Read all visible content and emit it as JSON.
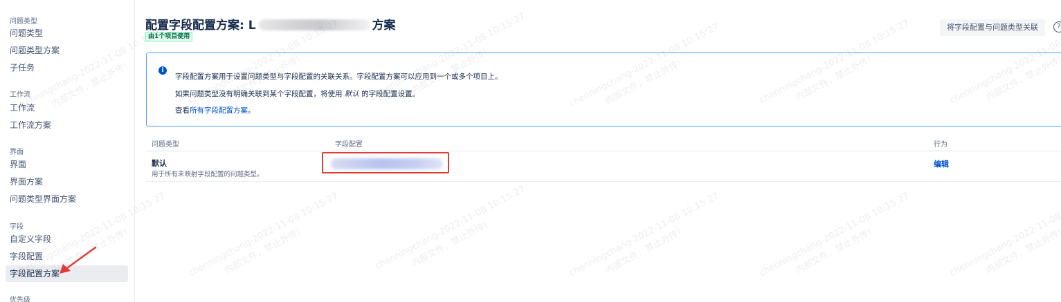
{
  "sidebar": {
    "groups": [
      {
        "title": "问题类型",
        "items": [
          "问题类型",
          "问题类型方案",
          "子任务"
        ]
      },
      {
        "title": "工作流",
        "items": [
          "工作流",
          "工作流方案"
        ]
      },
      {
        "title": "界面",
        "items": [
          "界面",
          "界面方案",
          "问题类型界面方案"
        ]
      },
      {
        "title": "字段",
        "items": [
          "自定义字段",
          "字段配置",
          "字段配置方案"
        ]
      },
      {
        "title": "优先级"
      }
    ],
    "active_item": "字段配置方案"
  },
  "header": {
    "title_prefix": "配置字段配置方案: L",
    "title_suffix": "方案",
    "used_badge": "由1个项目使用",
    "associate_button": "将字段配置与问题类型关联",
    "help_icon": "?"
  },
  "info": {
    "icon": "i",
    "line1": "字段配置方案用于设置问题类型与字段配置的关联关系。字段配置方案可以应用到一个或多个项目上。",
    "line2_before": "如果问题类型没有明确关联到某个字段配置，将使用",
    "line2_default": "默认",
    "line2_after": "的字段配置设置。",
    "line3_before": "查看",
    "line3_link": "所有字段配置方案",
    "line3_after": "。"
  },
  "table": {
    "columns": [
      "问题类型",
      "字段配置",
      "行为"
    ],
    "rows": [
      {
        "title": "默认",
        "description": "用于所有未映射字段配置的问题类型。",
        "action": "编辑"
      }
    ]
  },
  "watermark": {
    "line1": "chenningchang-2022-11-08 10:15:27",
    "line2": "内部文件，禁止外传!"
  },
  "colors": {
    "accent": "#0052cc",
    "info_border": "#4c9aff",
    "highlight": "#e53935",
    "badge_text": "#006644",
    "badge_bg": "#e3fcef"
  }
}
